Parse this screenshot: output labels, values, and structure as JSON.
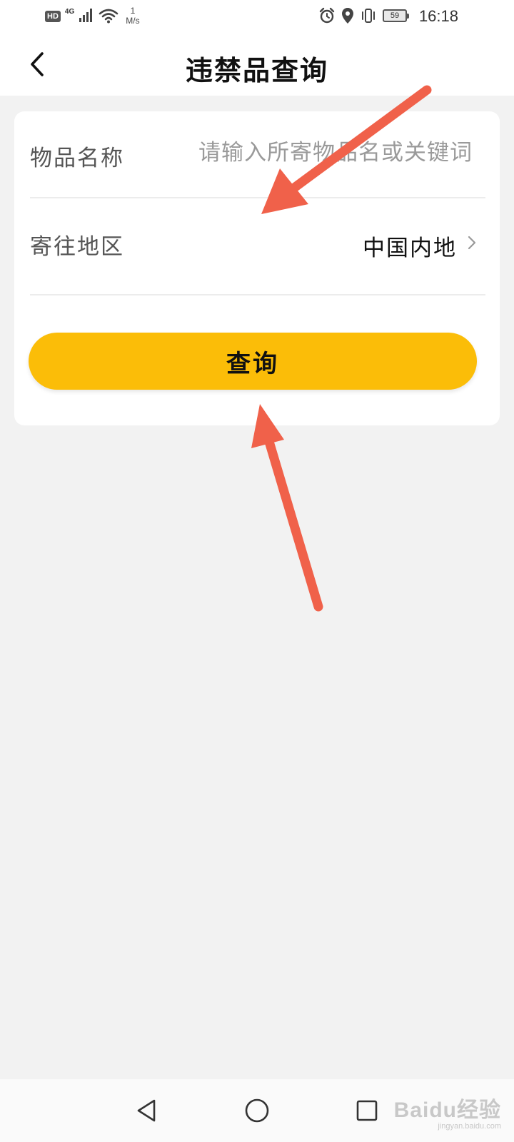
{
  "status_bar": {
    "hd": "HD",
    "network": "4G",
    "speed_value": "1",
    "speed_unit": "M/s",
    "battery": "59",
    "time": "16:18"
  },
  "header": {
    "title": "违禁品查询"
  },
  "form": {
    "item_name_label": "物品名称",
    "item_name_value": "",
    "item_name_placeholder": "请输入所寄物品名或关键词",
    "region_label": "寄往地区",
    "region_value": "中国内地",
    "query_label": "查询"
  },
  "watermark": {
    "brand": "Baidu经验",
    "url": "jingyan.baidu.com"
  },
  "colors": {
    "accent": "#fbbd08",
    "arrow": "#f0614a"
  }
}
